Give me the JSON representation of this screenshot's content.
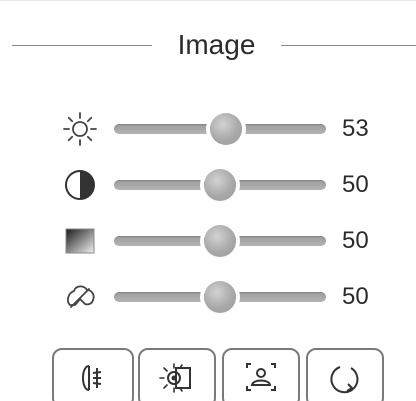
{
  "section": {
    "title": "Image"
  },
  "sliders": [
    {
      "name": "brightness",
      "icon": "brightness-sun-icon",
      "value": "53",
      "level": 0.53
    },
    {
      "name": "contrast",
      "icon": "contrast-icon",
      "value": "50",
      "level": 0.5
    },
    {
      "name": "saturation",
      "icon": "saturation-gradient-icon",
      "value": "50",
      "level": 0.5
    },
    {
      "name": "hue",
      "icon": "hue-icon",
      "value": "50",
      "level": 0.5
    }
  ],
  "buttons": [
    {
      "name": "lamp-button",
      "icon": "lamp-icon"
    },
    {
      "name": "lighting-button",
      "icon": "light-effect-icon"
    },
    {
      "name": "person-focus-button",
      "icon": "person-focus-icon"
    },
    {
      "name": "reset-button",
      "icon": "rotate-icon"
    }
  ],
  "colors": {
    "track": "#a8a8a8",
    "thumb": "#b0b0b0",
    "text": "#2b2b2b",
    "border": "#7a7a7a"
  }
}
